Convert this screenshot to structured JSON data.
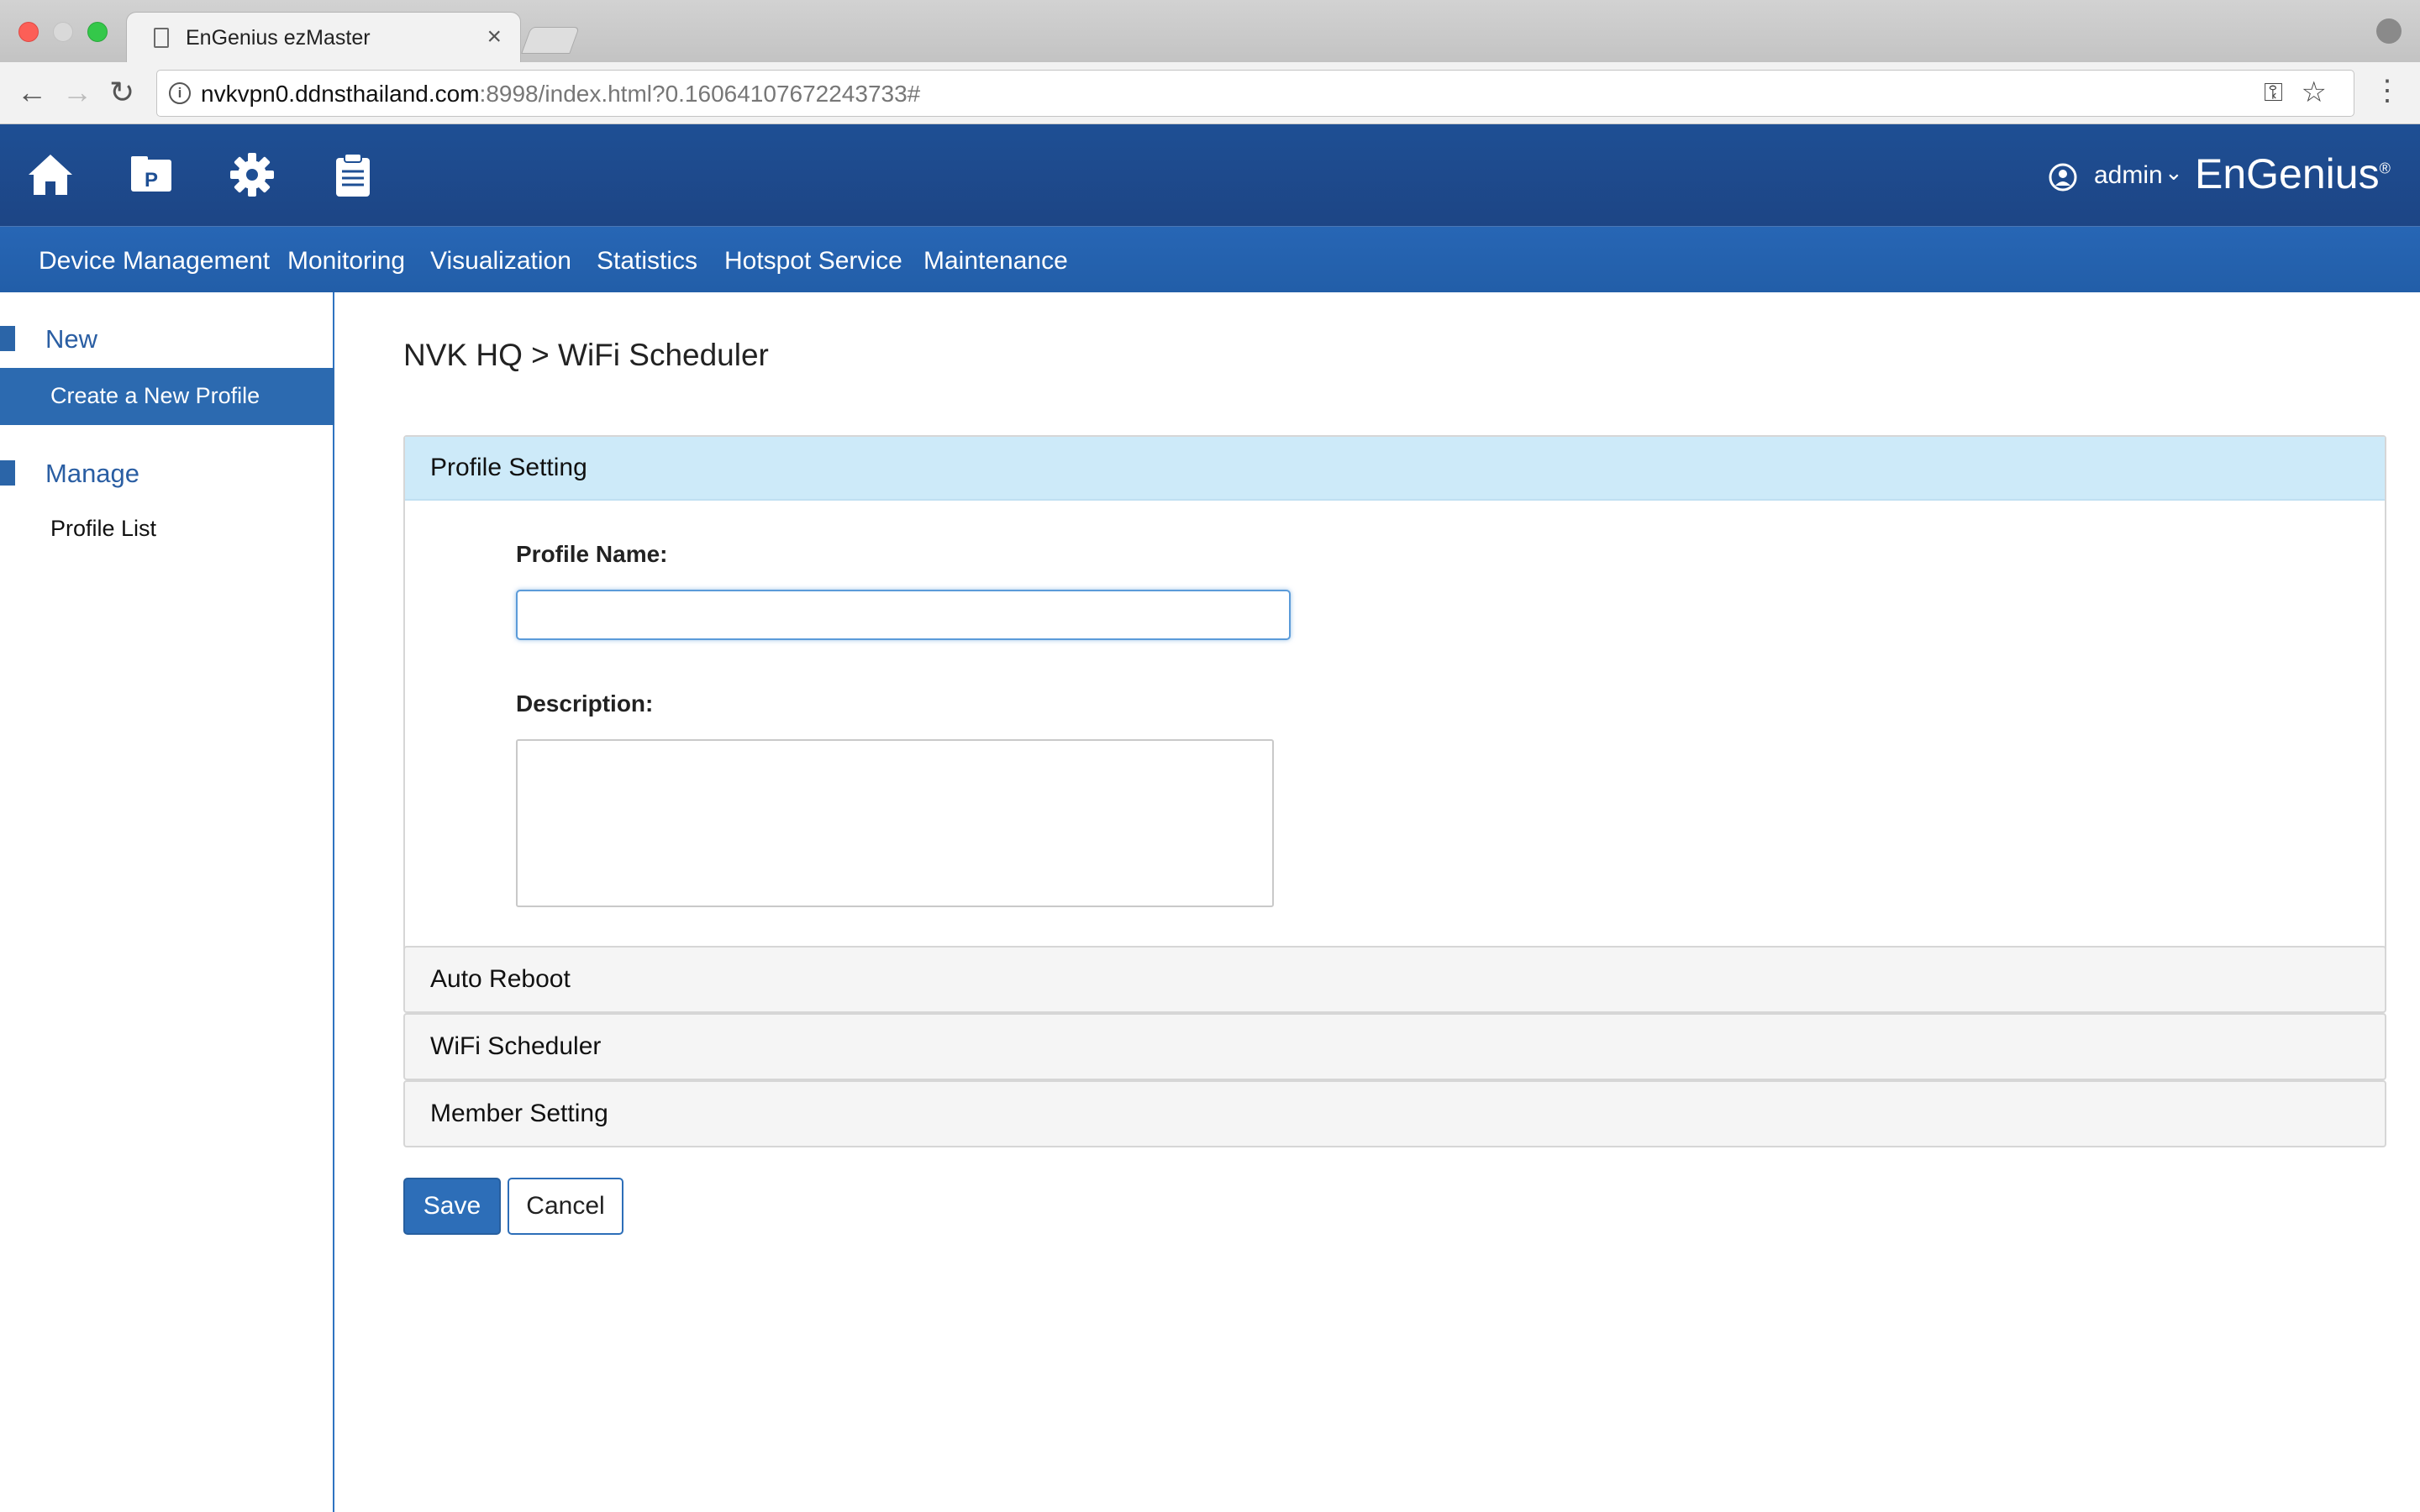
{
  "browser": {
    "tab_title": "EnGenius ezMaster",
    "tab_close": "×",
    "url_host": "nvkvpn0.ddnsthailand.com",
    "url_path": ":8998/index.html?0.16064107672243733#"
  },
  "header": {
    "icons": [
      "home-icon",
      "project-icon",
      "gear-icon",
      "clipboard-icon"
    ],
    "user": "admin",
    "brand": "EnGenius"
  },
  "nav": {
    "items": [
      "Device Management",
      "Monitoring",
      "Visualization",
      "Statistics",
      "Hotspot Service",
      "Maintenance"
    ]
  },
  "sidebar": {
    "new_title": "New",
    "create_profile": "Create a New Profile",
    "manage_title": "Manage",
    "profile_list": "Profile List"
  },
  "content": {
    "breadcrumb": "NVK HQ > WiFi Scheduler",
    "panel_profile": "Profile Setting",
    "label_name": "Profile Name:",
    "name_value": "",
    "label_description": "Description:",
    "description_value": "",
    "panel_reboot": "Auto Reboot",
    "panel_wifi": "WiFi Scheduler",
    "panel_member": "Member Setting",
    "save": "Save",
    "cancel": "Cancel"
  },
  "colors": {
    "header_blue": "#1e4f94",
    "nav_blue": "#2766b5",
    "active_item": "#2c6ab0",
    "panel_highlight": "#cdeaf9"
  }
}
